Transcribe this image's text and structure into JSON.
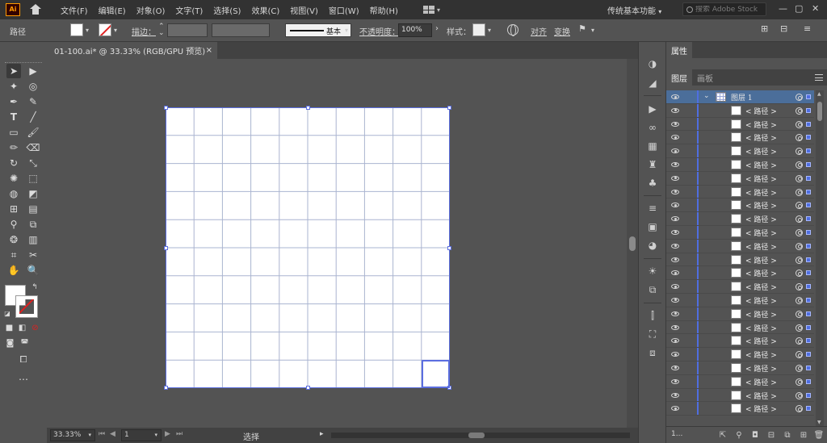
{
  "app": {
    "logo": "Ai"
  },
  "menu": {
    "items": [
      "文件(F)",
      "编辑(E)",
      "对象(O)",
      "文字(T)",
      "选择(S)",
      "效果(C)",
      "视图(V)",
      "窗口(W)",
      "帮助(H)"
    ],
    "workspace": "传统基本功能",
    "search_placeholder": "搜索 Adobe Stock",
    "window_buttons": {
      "minimize": "—",
      "restore": "▢",
      "close": "✕"
    }
  },
  "control_bar": {
    "object_type": "路径",
    "stroke_label": "描边：",
    "stroke_style": "基本",
    "opacity_label": "不透明度：",
    "opacity_value": "100%",
    "style_label": "样式：",
    "align_label": "对齐",
    "transform_label": "变换"
  },
  "document": {
    "tab_title": "01-100.ai* @ 33.33% (RGB/GPU 预览)",
    "close_glyph": "×"
  },
  "canvas": {
    "grid_columns": 10,
    "grid_rows": 10,
    "grid_line_color": "#aab4d0",
    "selection_color": "#5b6ee0",
    "artboard_color": "#ffffff"
  },
  "status_bar": {
    "zoom": "33.33%",
    "page": "1",
    "tool": "选择"
  },
  "layers_panel": {
    "header_tab": "属性",
    "tabs": [
      "图层",
      "画板"
    ],
    "layer_name": "图层 1",
    "sublayer_label": "< 路径 >",
    "visible_sublayer_count": 23,
    "footer_count": "1...",
    "layer_color": "#4f6ee0"
  }
}
